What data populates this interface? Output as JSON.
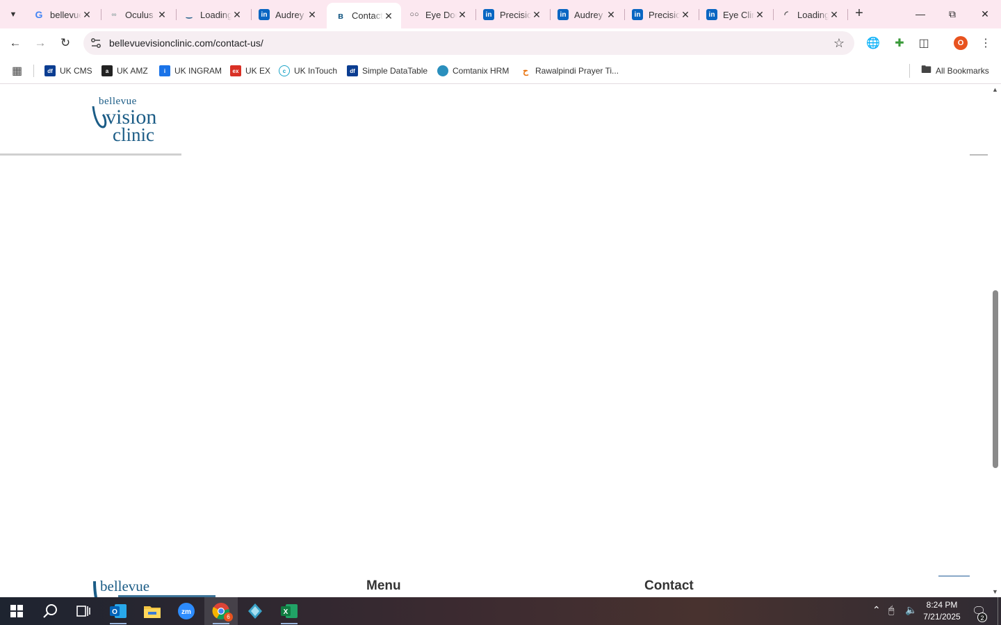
{
  "browser": {
    "tabs": [
      {
        "label": "bellevue vision clinic - Google Search",
        "favicon": "google-icon",
        "active": false
      },
      {
        "label": "Oculus Optometry",
        "favicon": "oculus-icon",
        "active": false
      },
      {
        "label": "Loading...",
        "favicon": "loading-icon",
        "active": false
      },
      {
        "label": "Audrey | LinkedIn",
        "favicon": "linkedin-icon",
        "active": false
      },
      {
        "label": "Contact Us",
        "favicon": "bellevue-icon",
        "active": true
      },
      {
        "label": "Eye Doctor",
        "favicon": "glasses-icon",
        "active": false
      },
      {
        "label": "Precision | LinkedIn",
        "favicon": "linkedin-icon",
        "active": false
      },
      {
        "label": "Audrey | LinkedIn",
        "favicon": "linkedin-icon",
        "active": false
      },
      {
        "label": "Precision | LinkedIn",
        "favicon": "linkedin-icon",
        "active": false
      },
      {
        "label": "Eye Clinic | LinkedIn",
        "favicon": "linkedin-icon",
        "active": false
      },
      {
        "label": "Loading...",
        "favicon": "spinner-icon",
        "active": false
      }
    ],
    "address": "bellevuevisionclinic.com/contact-us/",
    "profile_initial": "O",
    "bookmarks": [
      {
        "label": "UK CMS",
        "icon": "df-icon",
        "color": "#0b3d91"
      },
      {
        "label": "UK AMZ",
        "icon": "amazon-icon",
        "color": "#222222"
      },
      {
        "label": "UK INGRAM",
        "icon": "ingram-icon",
        "color": "#1a73e8"
      },
      {
        "label": "UK EX",
        "icon": "ex-icon",
        "color": "#d93025"
      },
      {
        "label": "UK InTouch",
        "icon": "intouch-icon",
        "color": "#1aa3c7"
      },
      {
        "label": "Simple DataTable",
        "icon": "df-icon",
        "color": "#0b3d91"
      },
      {
        "label": "Comtanix HRM",
        "icon": "comtanix-icon",
        "color": "#2a8fbd"
      },
      {
        "label": "Rawalpindi Prayer Ti...",
        "icon": "prayer-icon",
        "color": "#e8710a"
      }
    ],
    "all_bookmarks": "All Bookmarks"
  },
  "page": {
    "logo_text": {
      "line1": "bellevue",
      "line2": "vision",
      "line3": "clinic"
    },
    "footer": {
      "menu_heading": "Menu",
      "contact_heading": "Contact"
    },
    "brand_color": "#1b5c86"
  },
  "taskbar": {
    "apps": [
      "start-icon",
      "search-icon",
      "task-view-icon",
      "outlook-icon",
      "file-explorer-icon",
      "zoom-icon",
      "chrome-icon",
      "app-icon",
      "excel-icon"
    ],
    "chrome_badge": "6",
    "time": "8:24 PM",
    "date": "7/21/2025",
    "notifications": "2"
  }
}
